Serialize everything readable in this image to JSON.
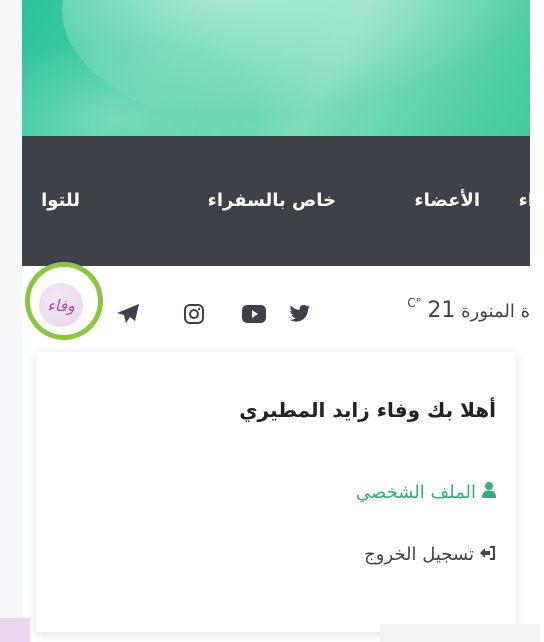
{
  "colors": {
    "navbar": "#3f4148",
    "accent_green": "#2fb07a",
    "highlight_ring": "#8cc63f"
  },
  "nav": {
    "item_partial_right": "اء",
    "item_members": "الأعضاء",
    "item_ambassadors": "خاص بالسفراء",
    "item_partial_left": "للتوا"
  },
  "info": {
    "city": "المنورة",
    "city_prefix": "ة",
    "temperature": "21",
    "unit": "°C"
  },
  "social_icons": [
    "twitter-icon",
    "youtube-icon",
    "instagram-icon",
    "telegram-icon"
  ],
  "avatar": {
    "initials": "وفاء"
  },
  "dropdown": {
    "greeting": "أهلا بك وفاء زايد المطيري",
    "profile_label": "الملف الشخصي",
    "logout_label": "تسجيل الخروج"
  }
}
